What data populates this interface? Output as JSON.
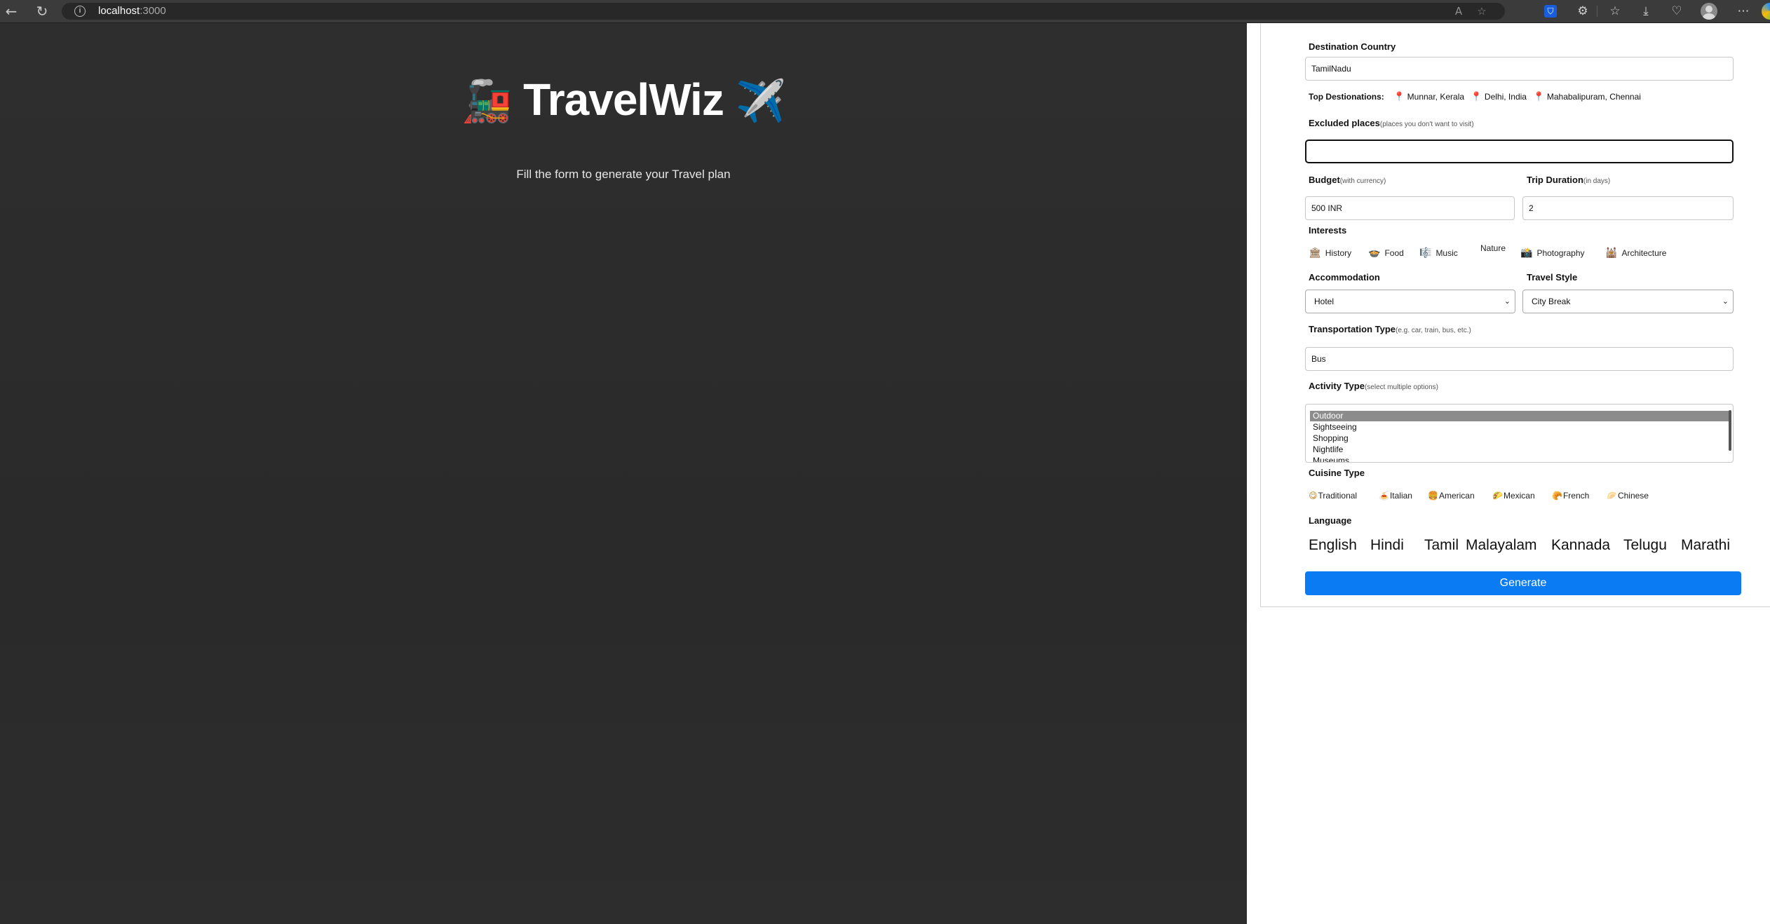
{
  "browser": {
    "url_host": "localhost",
    "url_port": ":3000",
    "icons": {
      "back": "back-arrow-icon",
      "reload": "reload-icon",
      "info": "site-info-icon",
      "read_aloud": "read-aloud-icon",
      "favorite": "star-icon",
      "bitwarden": "bitwarden-icon",
      "extensions": "extensions-icon",
      "favorites_bar": "favorites-icon",
      "downloads": "download-icon",
      "health": "browser-essentials-icon",
      "profile": "profile-avatar-icon",
      "more": "more-menu-icon"
    }
  },
  "hero": {
    "title": "TravelWiz",
    "emoji_left": "🚂",
    "emoji_right": "✈️",
    "subtitle": "Fill the form to generate your Travel plan"
  },
  "form": {
    "destination": {
      "label": "Destination Country",
      "value": "TamilNadu"
    },
    "top_destinations": {
      "label": "Top Destionations:",
      "items": [
        "Munnar, Kerala",
        "Delhi, India",
        "Mahabalipuram, Chennai"
      ]
    },
    "excluded": {
      "label": "Excluded places",
      "hint": "(places you don't want to visit)",
      "value": ""
    },
    "budget": {
      "label": "Budget",
      "hint": "(with currency)",
      "value": "500 INR"
    },
    "duration": {
      "label": "Trip Duration",
      "hint": "(in days)",
      "value": "2"
    },
    "interests": {
      "label": "Interests",
      "items": [
        {
          "icon": "🏛",
          "label": "History"
        },
        {
          "icon": "🍲",
          "label": "Food"
        },
        {
          "icon": "🎼",
          "label": "Music"
        },
        {
          "icon": "",
          "label": "Nature"
        },
        {
          "icon": "📸",
          "label": "Photography"
        },
        {
          "icon": "🕍",
          "label": "Architecture"
        }
      ]
    },
    "accommodation": {
      "label": "Accommodation",
      "value": "Hotel"
    },
    "travel_style": {
      "label": "Travel Style",
      "value": "City Break"
    },
    "transport": {
      "label": "Transportation Type",
      "hint": "(e.g. car, train, bus, etc.)",
      "value": "Bus"
    },
    "activity": {
      "label": "Activity Type",
      "hint": "(select multiple options)",
      "options": [
        "Outdoor",
        "Sightseeing",
        "Shopping",
        "Nightlife",
        "Museums"
      ],
      "selected": "Outdoor"
    },
    "cuisine": {
      "label": "Cuisine Type",
      "items": [
        {
          "icon": "😋",
          "label": "Traditional"
        },
        {
          "icon": "🍝",
          "label": "Italian"
        },
        {
          "icon": "🍔",
          "label": "American"
        },
        {
          "icon": "🌮",
          "label": "Mexican"
        },
        {
          "icon": "🥐",
          "label": "French"
        },
        {
          "icon": "🥟",
          "label": "Chinese"
        }
      ]
    },
    "language": {
      "label": "Language",
      "items": [
        "English",
        "Hindi",
        "Tamil",
        "Malayalam",
        "Kannada",
        "Telugu",
        "Marathi"
      ]
    },
    "generate_label": "Generate"
  },
  "colors": {
    "left_bg": "#2b2b2b",
    "accent_button": "#0b7bf4"
  }
}
